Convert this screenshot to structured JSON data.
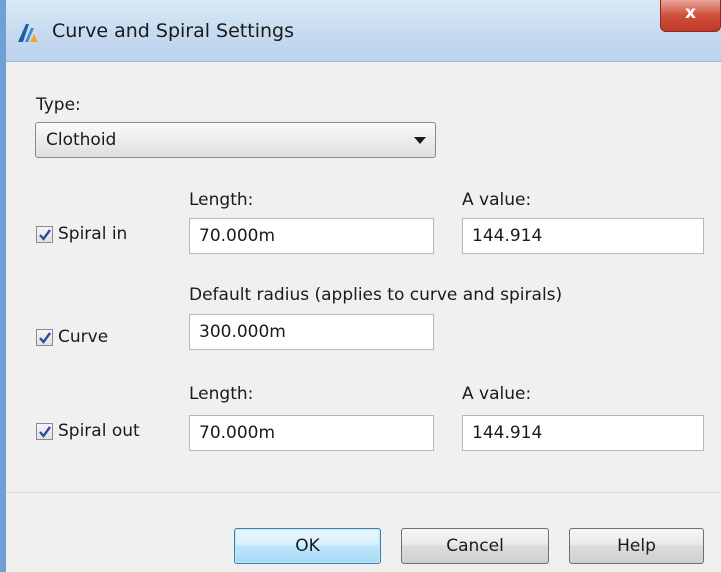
{
  "window": {
    "title": "Curve and Spiral Settings",
    "close_label": "x"
  },
  "form": {
    "type_label": "Type:",
    "type_value": "Clothoid",
    "spiral_in": {
      "checkbox_label": "Spiral in",
      "checked": true,
      "length_label": "Length:",
      "length_value": "70.000m",
      "a_value_label": "A value:",
      "a_value": "144.914"
    },
    "curve": {
      "checkbox_label": "Curve",
      "checked": true,
      "radius_label": "Default radius (applies to curve and spirals)",
      "radius_value": "300.000m"
    },
    "spiral_out": {
      "checkbox_label": "Spiral out",
      "checked": true,
      "length_label": "Length:",
      "length_value": "70.000m",
      "a_value_label": "A value:",
      "a_value": "144.914"
    }
  },
  "buttons": {
    "ok": "OK",
    "cancel": "Cancel",
    "help": "Help"
  },
  "icons": {
    "app": "app-logo-icon",
    "check": "checkmark-icon",
    "dropdown": "chevron-down-icon"
  },
  "colors": {
    "window_border": "#6fa0d6",
    "close_button": "#c03a26",
    "dialog_background": "#f0f0f0",
    "default_button_border": "#3c7fb1"
  }
}
